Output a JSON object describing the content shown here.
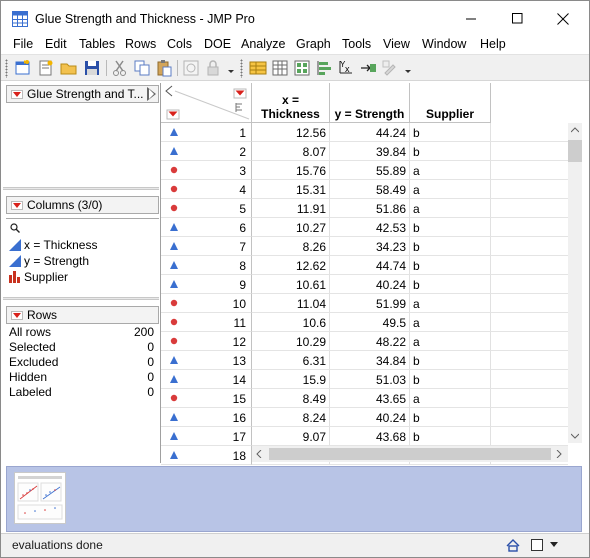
{
  "window": {
    "title": "Glue Strength and Thickness - JMP Pro"
  },
  "menu": [
    "File",
    "Edit",
    "Tables",
    "Rows",
    "Cols",
    "DOE",
    "Analyze",
    "Graph",
    "Tools",
    "View",
    "Window",
    "Help"
  ],
  "table_panel": {
    "title": "Glue Strength and T..."
  },
  "columns_panel": {
    "title": "Columns (3/0)",
    "items": [
      {
        "label": "x = Thickness",
        "icon": "continuous-icon"
      },
      {
        "label": "y = Strength",
        "icon": "continuous-icon"
      },
      {
        "label": "Supplier",
        "icon": "nominal-icon"
      }
    ]
  },
  "rows_panel": {
    "title": "Rows",
    "items": [
      {
        "label": "All rows",
        "value": "200"
      },
      {
        "label": "Selected",
        "value": "0"
      },
      {
        "label": "Excluded",
        "value": "0"
      },
      {
        "label": "Hidden",
        "value": "0"
      },
      {
        "label": "Labeled",
        "value": "0"
      }
    ]
  },
  "grid": {
    "columns": [
      {
        "line1": "x =",
        "line2": "Thickness"
      },
      {
        "line1": "",
        "line2": "y = Strength"
      },
      {
        "line1": "",
        "line2": "Supplier"
      }
    ],
    "rows": [
      {
        "n": "1",
        "marker": "triangle",
        "x": "12.56",
        "y": "44.24",
        "s": "b"
      },
      {
        "n": "2",
        "marker": "triangle",
        "x": "8.07",
        "y": "39.84",
        "s": "b"
      },
      {
        "n": "3",
        "marker": "circle",
        "x": "15.76",
        "y": "55.89",
        "s": "a"
      },
      {
        "n": "4",
        "marker": "circle",
        "x": "15.31",
        "y": "58.49",
        "s": "a"
      },
      {
        "n": "5",
        "marker": "circle",
        "x": "11.91",
        "y": "51.86",
        "s": "a"
      },
      {
        "n": "6",
        "marker": "triangle",
        "x": "10.27",
        "y": "42.53",
        "s": "b"
      },
      {
        "n": "7",
        "marker": "triangle",
        "x": "8.26",
        "y": "34.23",
        "s": "b"
      },
      {
        "n": "8",
        "marker": "triangle",
        "x": "12.62",
        "y": "44.74",
        "s": "b"
      },
      {
        "n": "9",
        "marker": "triangle",
        "x": "10.61",
        "y": "40.24",
        "s": "b"
      },
      {
        "n": "10",
        "marker": "circle",
        "x": "11.04",
        "y": "51.99",
        "s": "a"
      },
      {
        "n": "11",
        "marker": "circle",
        "x": "10.6",
        "y": "49.5",
        "s": "a"
      },
      {
        "n": "12",
        "marker": "circle",
        "x": "10.29",
        "y": "48.22",
        "s": "a"
      },
      {
        "n": "13",
        "marker": "triangle",
        "x": "6.31",
        "y": "34.84",
        "s": "b"
      },
      {
        "n": "14",
        "marker": "triangle",
        "x": "15.9",
        "y": "51.03",
        "s": "b"
      },
      {
        "n": "15",
        "marker": "circle",
        "x": "8.49",
        "y": "43.65",
        "s": "a"
      },
      {
        "n": "16",
        "marker": "triangle",
        "x": "8.24",
        "y": "40.24",
        "s": "b"
      },
      {
        "n": "17",
        "marker": "triangle",
        "x": "9.07",
        "y": "43.68",
        "s": "b"
      },
      {
        "n": "18",
        "marker": "triangle",
        "x": "",
        "y": "",
        "s": ""
      }
    ]
  },
  "status": {
    "text": "evaluations done"
  },
  "colors": {
    "triangle": "#3a6fd0",
    "circle": "#d93b3b",
    "redtri": "#d8221c",
    "thumb_bg": "#b8c4e6"
  }
}
